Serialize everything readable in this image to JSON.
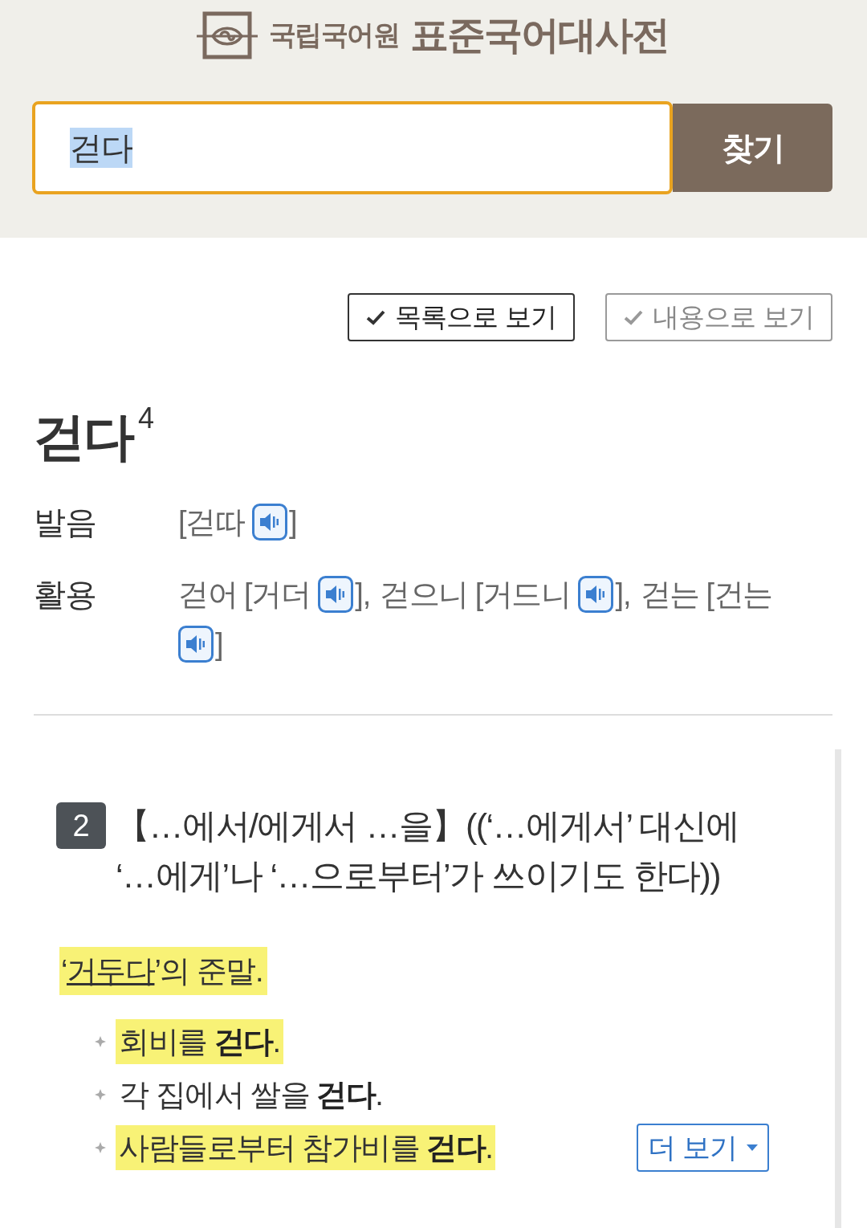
{
  "header": {
    "logo": {
      "org": "국립국어원",
      "title": "표준국어대사전"
    },
    "search": {
      "value": "걷다",
      "value_selected": true,
      "button": "찾기"
    }
  },
  "view_buttons": [
    {
      "label": "목록으로 보기",
      "selected": true
    },
    {
      "label": "내용으로 보기",
      "selected": false
    }
  ],
  "entry": {
    "headword": "걷다",
    "homonym_number": "4",
    "info": [
      {
        "label": "발음",
        "items": [
          {
            "before": "[걷따",
            "after": "]"
          }
        ]
      },
      {
        "label": "활용",
        "items": [
          {
            "before": "걷어 [거더",
            "after": "],"
          },
          {
            "before": "걷으니 [거드니",
            "after": "],"
          },
          {
            "before": "걷는 [건는",
            "after": "]"
          }
        ]
      }
    ],
    "sense": {
      "number": "2",
      "grammar": "【…에서/에게서 …을】((‘…에게서’ 대신에 ‘…에게’나 ‘…으로부터’가 쓰이기도 한다))",
      "definition": {
        "before": "‘",
        "link": "거두다",
        "after": "’의 준말.",
        "highlighted": true
      },
      "examples": [
        {
          "text": "회비를 **걷다**.",
          "highlighted": true
        },
        {
          "text": "각 집에서 쌀을 **걷다**.",
          "highlighted": false
        },
        {
          "text": "사람들로부터 참가비를 **걷다**.",
          "highlighted": true
        }
      ],
      "more_button": "더 보기"
    }
  }
}
